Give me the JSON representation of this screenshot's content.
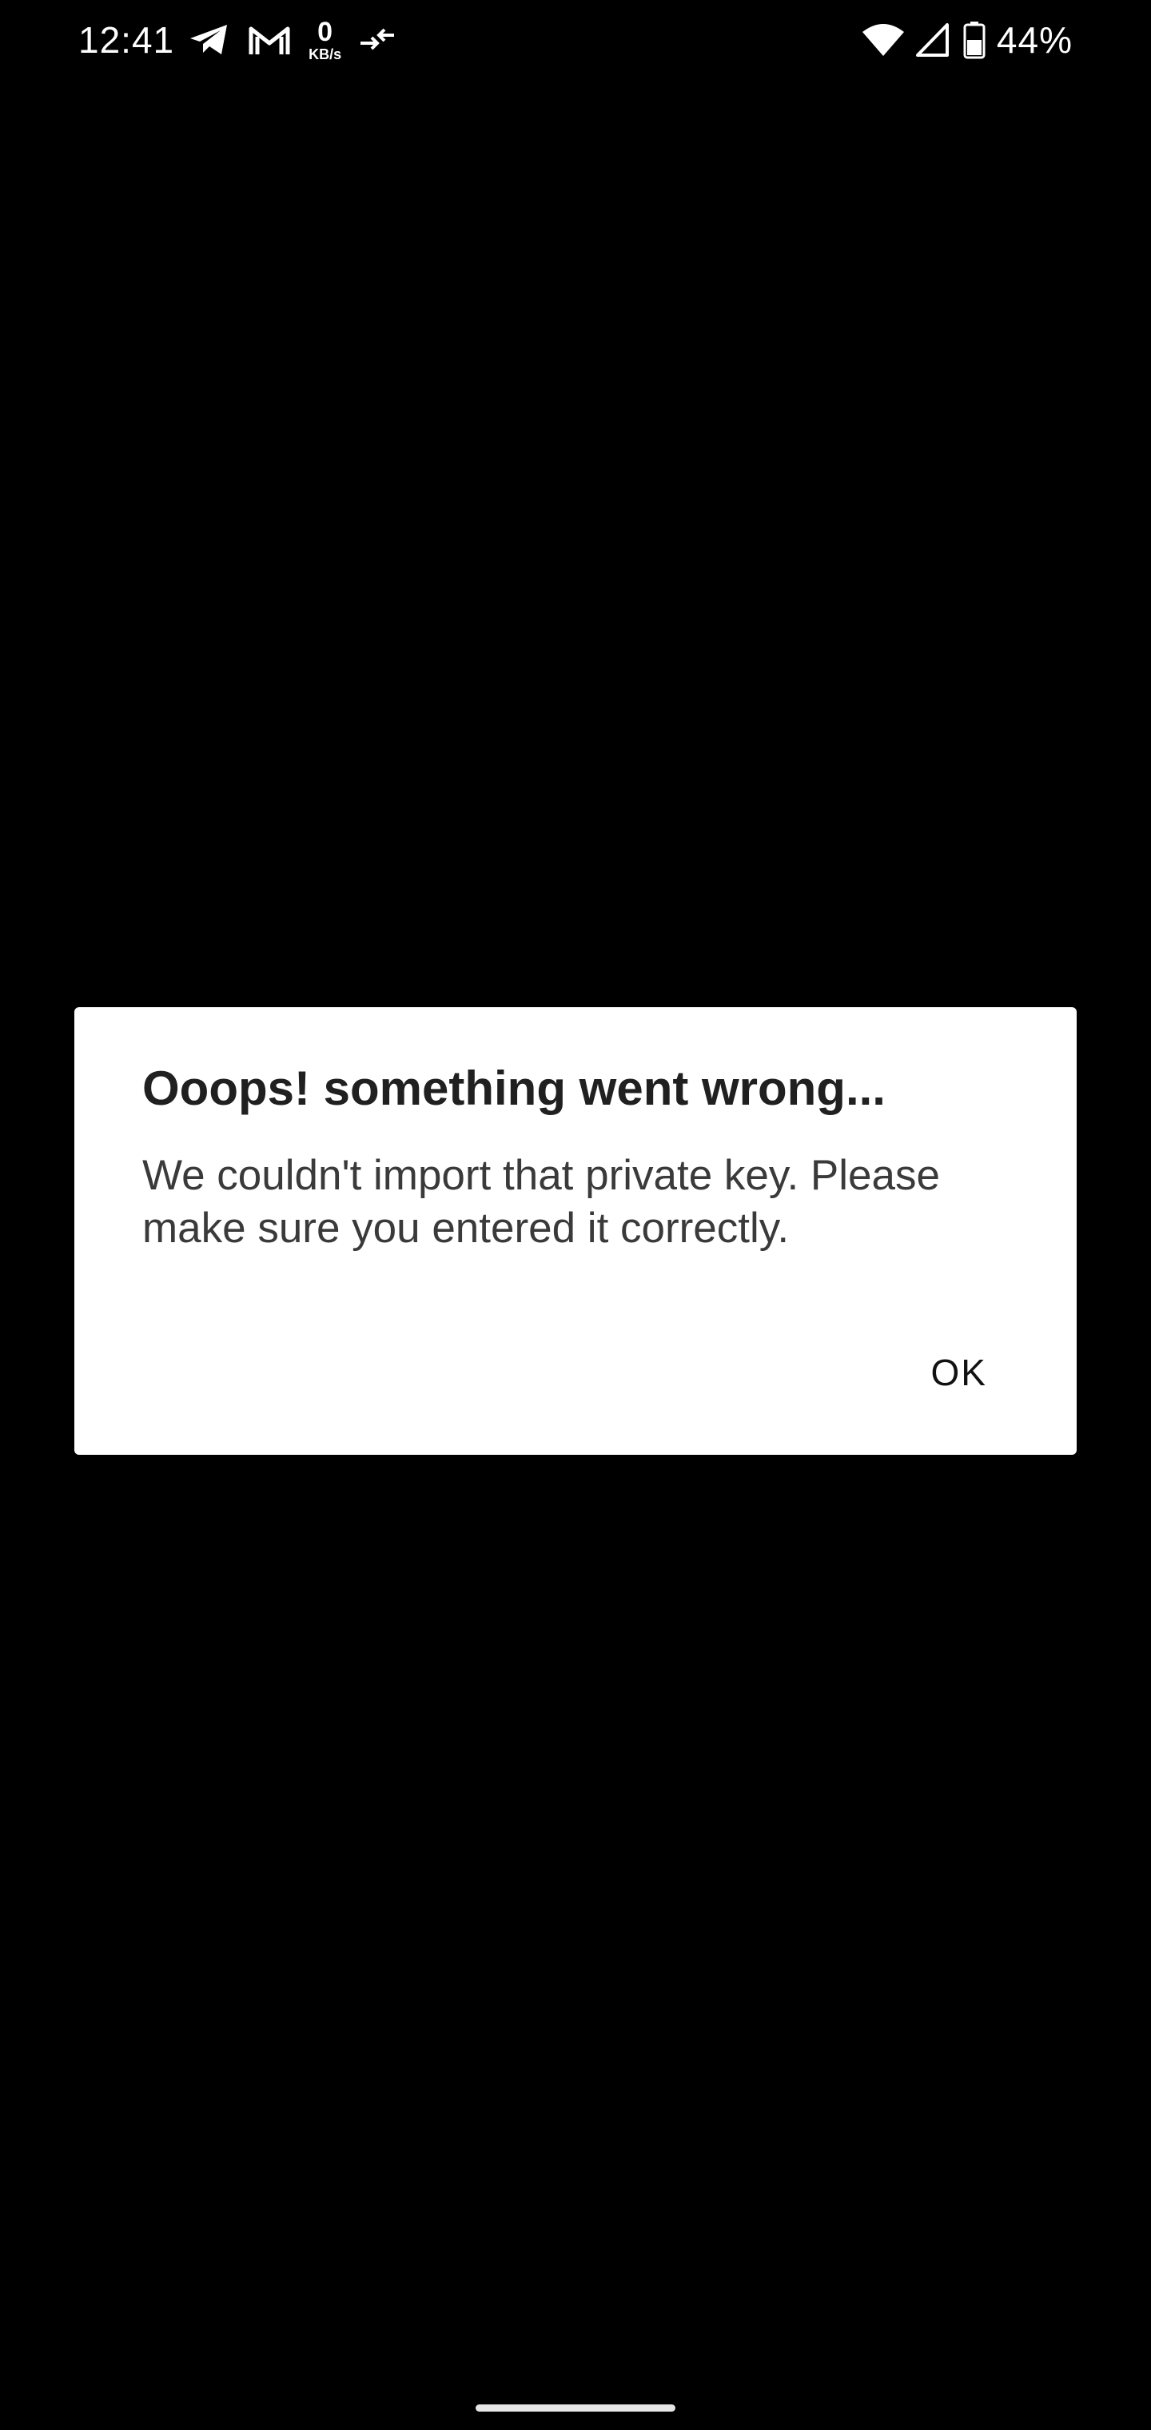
{
  "status_bar": {
    "time": "12:41",
    "netspeed_value": "0",
    "netspeed_unit": "KB/s",
    "battery_percent": "44%",
    "icons": [
      "telegram-icon",
      "gmail-icon",
      "data-transfer-icon",
      "wifi-icon",
      "cell-signal-icon",
      "battery-icon"
    ]
  },
  "dialog": {
    "title": "Ooops! something went wrong...",
    "message": "We couldn't import that private key. Please make sure you entered it correctly.",
    "ok_label": "OK"
  },
  "colors": {
    "background": "#000000",
    "dialog_background": "#ffffff",
    "text_primary": "#202020"
  }
}
